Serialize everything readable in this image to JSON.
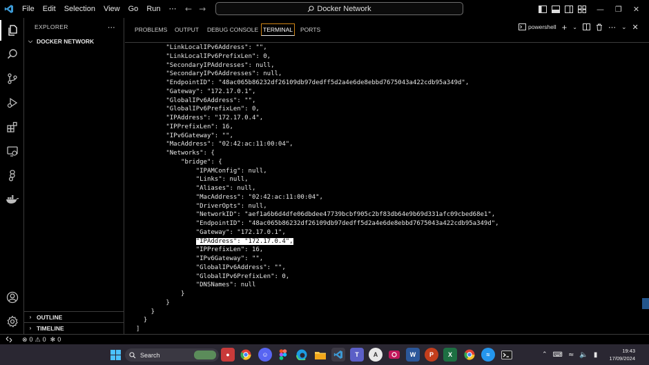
{
  "titlebar": {
    "menu": [
      "File",
      "Edit",
      "Selection",
      "View",
      "Go",
      "Run"
    ],
    "more": "⋯",
    "search_text": "Docker Network",
    "colors": {
      "vscode_blue": "#3c99d4"
    }
  },
  "sidebar": {
    "header": "EXPLORER",
    "more": "⋯",
    "folder": "DOCKER NETWORK",
    "outline": "OUTLINE",
    "timeline": "TIMELINE"
  },
  "panel": {
    "tabs": [
      "PROBLEMS",
      "OUTPUT",
      "DEBUG CONSOLE",
      "TERMINAL",
      "PORTS"
    ],
    "active_tab": "TERMINAL",
    "shell": "powershell",
    "terminal_lines": [
      "        \"LinkLocalIPv6Address\": \"\",",
      "        \"LinkLocalIPv6PrefixLen\": 0,",
      "        \"SecondaryIPAddresses\": null,",
      "        \"SecondaryIPv6Addresses\": null,",
      "        \"EndpointID\": \"48ac065b86232df26109db97dedff5d2a4e6de8ebbd7675043a422cdb95a349d\",",
      "        \"Gateway\": \"172.17.0.1\",",
      "        \"GlobalIPv6Address\": \"\",",
      "        \"GlobalIPv6PrefixLen\": 0,",
      "        \"IPAddress\": \"172.17.0.4\",",
      "        \"IPPrefixLen\": 16,",
      "        \"IPv6Gateway\": \"\",",
      "        \"MacAddress\": \"02:42:ac:11:00:04\",",
      "        \"Networks\": {",
      "            \"bridge\": {",
      "                \"IPAMConfig\": null,",
      "                \"Links\": null,",
      "                \"Aliases\": null,",
      "                \"MacAddress\": \"02:42:ac:11:00:04\",",
      "                \"DriverOpts\": null,",
      "                \"NetworkID\": \"aef1a6b6d4dfe06dbdee47739bcbf905c2bf83db64e9b69d331afc09cbed68e1\",",
      "                \"EndpointID\": \"48ac065b86232df26109db97dedff5d2a4e6de8ebbd7675043a422cdb95a349d\",",
      "                \"Gateway\": \"172.17.0.1\",",
      "                \"IPAddress\": \"172.17.0.4\",",
      "                \"IPPrefixLen\": 16,",
      "                \"IPv6Gateway\": \"\",",
      "                \"GlobalIPv6Address\": \"\",",
      "                \"GlobalIPv6PrefixLen\": 0,",
      "                \"DNSNames\": null",
      "            }",
      "        }",
      "    }",
      "  }",
      "]"
    ],
    "highlighted_line": 22
  },
  "statusbar": {
    "errors": "0",
    "warnings": "0",
    "ports": "0"
  },
  "taskbar": {
    "search_label": "Search",
    "clock_time": "19:43",
    "clock_date": "17/09/2024"
  }
}
